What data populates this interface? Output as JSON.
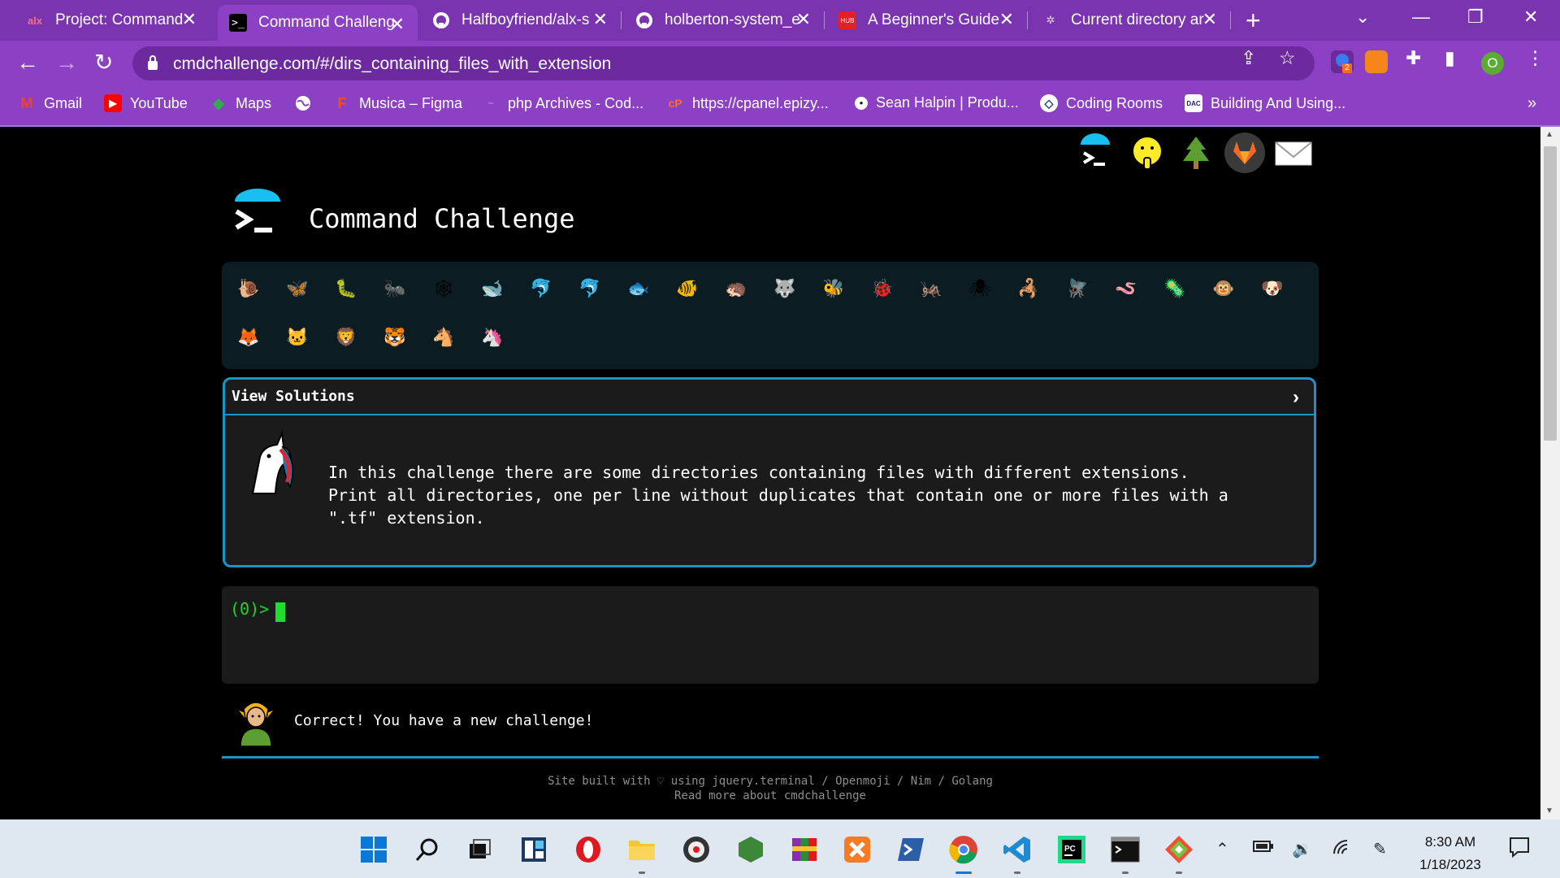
{
  "tabs": [
    {
      "title": "Project: Command",
      "favicon": "alx"
    },
    {
      "title": "Command Challeng",
      "favicon": ">_"
    },
    {
      "title": "Halfboyfriend/alx-s",
      "favicon": "github"
    },
    {
      "title": "holberton-system_e",
      "favicon": "github"
    },
    {
      "title": "A Beginner's Guide",
      "favicon": "HUB"
    },
    {
      "title": "Current directory ar",
      "favicon": "bug"
    }
  ],
  "address_bar": {
    "url": "cmdchallenge.com/#/dirs_containing_files_with_extension"
  },
  "extensions": {
    "badge": "2"
  },
  "profile_initial": "O",
  "bookmarks": [
    {
      "label": "Gmail",
      "icon": "M"
    },
    {
      "label": "YouTube",
      "icon": "▶"
    },
    {
      "label": "Maps",
      "icon": "◆"
    },
    {
      "label": "",
      "icon": "globe"
    },
    {
      "label": "Musica – Figma",
      "icon": "F"
    },
    {
      "label": "php Archives - Cod...",
      "icon": "~"
    },
    {
      "label": "https://cpanel.epizy...",
      "icon": "cP"
    },
    {
      "label": "Sean Halpin | Produ...",
      "icon": "●"
    },
    {
      "label": "Coding Rooms",
      "icon": "◇"
    },
    {
      "label": "Building And Using...",
      "icon": "DAC"
    }
  ],
  "page": {
    "title": "Command Challenge",
    "animals_row1": [
      "🐌",
      "🦋",
      "🐛",
      "🐜",
      "🕸",
      "🐋",
      "🐬",
      "🐬",
      "🐟",
      "🐠",
      "🦔",
      "🐺",
      "🐝",
      "🐞",
      "🦗",
      "🕷",
      "🦂",
      "🪰",
      "🪱",
      "🦠",
      "🐵",
      "🐶"
    ],
    "animals_row2": [
      "🦊",
      "🐱",
      "🦁",
      "🐯",
      "🐴",
      "🦄"
    ],
    "challenge": {
      "header": "View Solutions",
      "lines": [
        "In this challenge there are some directories containing files with different extensions.",
        "Print all directories, one per line without duplicates that contain one or more files with a",
        "\".tf\" extension."
      ]
    },
    "terminal": {
      "prompt": "(0)>"
    },
    "status": "Correct! You have a new challenge!",
    "footer": {
      "line1": "Site built with ♡ using jquery.terminal / Openmoji / Nim / Golang",
      "line2": "Read more about cmdchallenge"
    }
  },
  "taskbar": {
    "time": "8:30 AM",
    "date": "1/18/2023"
  },
  "colors": {
    "chrome_purple": "#8c41c4",
    "accent_blue": "#1895c6",
    "prompt_green": "#1fd52f",
    "terminal_bg": "#1b1b1b"
  }
}
